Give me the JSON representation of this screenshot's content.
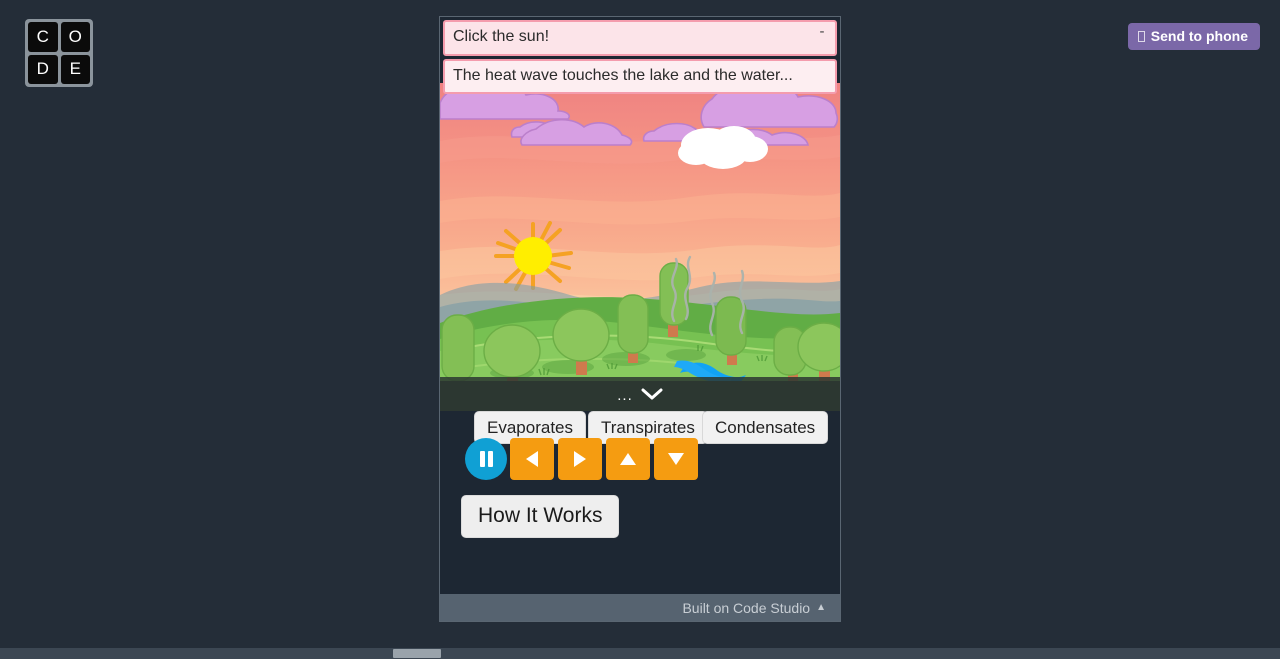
{
  "background_color": "#242d38",
  "logo": {
    "name": "code-logo",
    "tiles": [
      "C",
      "O",
      "D",
      "E"
    ]
  },
  "send_to_phone": {
    "label": "Send to phone",
    "icon": "phone-icon",
    "color": "#7b68a8"
  },
  "app": {
    "bubbles": [
      {
        "text": "Click the sun!",
        "collapse_label": "-"
      },
      {
        "text": "The heat wave touches the lake and the water..."
      }
    ],
    "strip": {
      "dots": "...",
      "icon": "chevron-down-icon"
    },
    "word_buttons": [
      {
        "label": "Evaporates"
      },
      {
        "label": "Transpirates"
      },
      {
        "label": "Condensates"
      }
    ],
    "controls": [
      {
        "name": "pause-button",
        "icon": "pause-icon",
        "color": "#10a0d4"
      },
      {
        "name": "arrow-left-button",
        "icon": "triangle-left-icon",
        "color": "#f59c11"
      },
      {
        "name": "arrow-right-button",
        "icon": "triangle-right-icon",
        "color": "#f59c11"
      },
      {
        "name": "arrow-up-button",
        "icon": "triangle-up-icon",
        "color": "#f59c11"
      },
      {
        "name": "arrow-down-button",
        "icon": "triangle-down-icon",
        "color": "#f59c11"
      }
    ],
    "how_it_works": {
      "label": "How It Works"
    },
    "footer": {
      "label": "Built on Code Studio",
      "caret": "▲"
    },
    "scene": {
      "description": "Sunset landscape with sun, clouds, green hills, trees and a blue river",
      "sun_color": "#ffee00",
      "ray_color": "#f5a223",
      "cloud_color": "#d89fe0",
      "white_cloud_color": "#ffffff",
      "water_color": "#11a3f5",
      "hill_colors": [
        "#5da83f",
        "#79bf4d",
        "#9acb5e"
      ]
    }
  }
}
